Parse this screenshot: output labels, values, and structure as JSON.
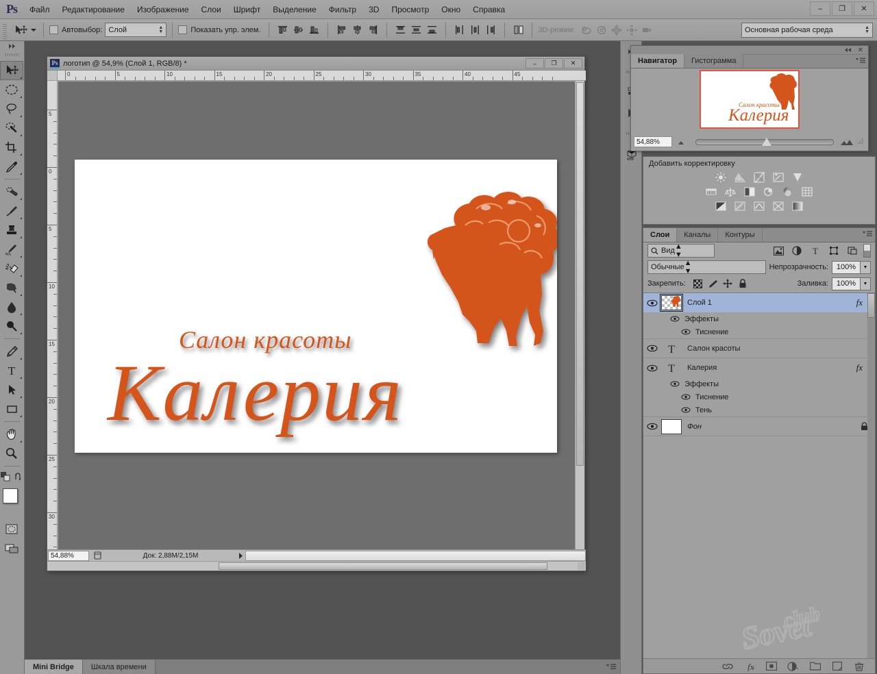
{
  "app": {
    "logo": "Ps",
    "menus": [
      "Файл",
      "Редактирование",
      "Изображение",
      "Слои",
      "Шрифт",
      "Выделение",
      "Фильтр",
      "3D",
      "Просмотр",
      "Окно",
      "Справка"
    ],
    "window_buttons": {
      "minimize": "–",
      "restore": "❐",
      "close": "✕"
    }
  },
  "options_bar": {
    "move_tool_icon": "move-tool-icon",
    "auto_select_label": "Автовыбор:",
    "auto_select_value": "Слой",
    "show_transform_label": "Показать упр. элем.",
    "mode_3d_label": "3D-режим:",
    "workspace_value": "Основная рабочая среда",
    "align_icons": [
      "align-top-edges-icon",
      "align-vertical-centers-icon",
      "align-bottom-edges-icon",
      "align-left-edges-icon",
      "align-horizontal-centers-icon",
      "align-right-edges-icon",
      "distribute-top-icon",
      "distribute-vertical-center-icon",
      "distribute-bottom-icon",
      "distribute-left-icon",
      "distribute-horizontal-center-icon",
      "distribute-right-icon",
      "auto-align-layers-icon"
    ],
    "icons_3d": [
      "rotate-3d-icon",
      "roll-3d-icon",
      "pan-3d-icon",
      "slide-3d-icon",
      "scale-3d-icon"
    ]
  },
  "toolbox": {
    "tools": [
      {
        "name": "move-tool",
        "active": true
      },
      {
        "name": "elliptical-marquee-tool",
        "active": false
      },
      {
        "name": "lasso-tool",
        "active": false
      },
      {
        "name": "quick-selection-tool",
        "active": false
      },
      {
        "name": "crop-tool",
        "active": false
      },
      {
        "name": "eyedropper-tool",
        "active": false
      },
      {
        "name": "spot-healing-brush-tool",
        "active": false
      },
      {
        "name": "brush-tool",
        "active": false
      },
      {
        "name": "clone-stamp-tool",
        "active": false
      },
      {
        "name": "history-brush-tool",
        "active": false
      },
      {
        "name": "eraser-tool",
        "active": false
      },
      {
        "name": "gradient-tool",
        "active": false
      },
      {
        "name": "blur-tool",
        "active": false
      },
      {
        "name": "dodge-tool",
        "active": false
      },
      {
        "name": "pen-tool",
        "active": false
      },
      {
        "name": "horizontal-type-tool",
        "active": false
      },
      {
        "name": "path-selection-tool",
        "active": false
      },
      {
        "name": "rectangle-tool",
        "active": false
      },
      {
        "name": "hand-tool",
        "active": false
      },
      {
        "name": "zoom-tool",
        "active": false
      }
    ],
    "foreground_color": "#ffffff",
    "background_color": "#ffffff"
  },
  "document": {
    "title": "логотип @ 54,9% (Слой 1, RGB/8) *",
    "zoom_status": "54,88%",
    "doc_size": "Док: 2,88M/2,15M",
    "ruler_h_labels": [
      "0",
      "5",
      "10",
      "15",
      "20",
      "25",
      "30",
      "35",
      "40",
      "45"
    ],
    "ruler_v_labels": [
      "5",
      "0",
      "5",
      "10",
      "15",
      "20",
      "25",
      "30",
      "35"
    ],
    "window_buttons": {
      "minimize": "–",
      "restore": "❐",
      "close": "✕"
    }
  },
  "artwork": {
    "tagline": "Салон красоты",
    "brand": "Калерия",
    "accent_color": "#d4541c",
    "background_color": "#ffffff"
  },
  "navigator": {
    "tabs": [
      {
        "label": "Навигатор",
        "active": true
      },
      {
        "label": "Гистограмма",
        "active": false
      }
    ],
    "zoom_value": "54,88%",
    "collapse_icon": "collapse-panel-icon",
    "close_icon": "close-icon",
    "menu_icon": "panel-menu-icon",
    "zoom_out_icon": "zoom-out-icon",
    "zoom_in_icon": "zoom-in-icon"
  },
  "adjustments": {
    "title": "Добавить корректировку",
    "row1": [
      "brightness-contrast-icon",
      "levels-icon",
      "curves-icon",
      "exposure-icon",
      "vibrance-icon"
    ],
    "row2": [
      "hue-saturation-icon",
      "color-balance-icon",
      "black-white-icon",
      "photo-filter-icon",
      "channel-mixer-icon",
      "color-lookup-icon"
    ],
    "row3": [
      "invert-icon",
      "posterize-icon",
      "threshold-icon",
      "selective-color-icon",
      "gradient-map-icon"
    ]
  },
  "layers_panel": {
    "tabs": [
      {
        "label": "Слои",
        "active": true
      },
      {
        "label": "Каналы",
        "active": false
      },
      {
        "label": "Контуры",
        "active": false
      }
    ],
    "filter_value": "Вид",
    "filter_icons": [
      "filter-pixel-icon",
      "filter-adjustment-icon",
      "filter-type-icon",
      "filter-shape-icon",
      "filter-smart-object-icon"
    ],
    "blend_mode": "Обычные",
    "opacity_label": "Непрозрачность:",
    "opacity_value": "100%",
    "lock_label": "Закрепить:",
    "lock_icons": [
      "lock-transparent-pixels-icon",
      "lock-image-pixels-icon",
      "lock-position-icon",
      "lock-all-icon"
    ],
    "fill_label": "Заливка:",
    "fill_value": "100%",
    "layers": [
      {
        "name": "Слой 1",
        "selected": true,
        "has_fx": true,
        "thumb": "transparent-artwork",
        "effects_label": "Эффекты",
        "effects": [
          "Тиснение"
        ]
      },
      {
        "name": "Салон красоты",
        "selected": false,
        "has_fx": false,
        "thumb": "type",
        "effects": []
      },
      {
        "name": "Калерия",
        "selected": false,
        "has_fx": true,
        "thumb": "type",
        "effects_label": "Эффекты",
        "effects": [
          "Тиснение",
          "Тень"
        ]
      },
      {
        "name": "Фон",
        "selected": false,
        "has_fx": false,
        "thumb": "white",
        "locked": true,
        "effects": []
      }
    ],
    "footer_icons": [
      "link-layers-icon",
      "add-layer-style-icon",
      "add-layer-mask-icon",
      "new-adjustment-layer-icon",
      "new-group-icon",
      "new-layer-icon",
      "delete-layer-icon"
    ]
  },
  "bottom_bar": {
    "tabs": [
      {
        "label": "Mini Bridge",
        "active": true
      },
      {
        "label": "Шкала времени",
        "active": false
      }
    ],
    "menu_icon": "panel-menu-icon"
  },
  "watermark": {
    "text_top": "club",
    "text_main": "Sovet"
  }
}
